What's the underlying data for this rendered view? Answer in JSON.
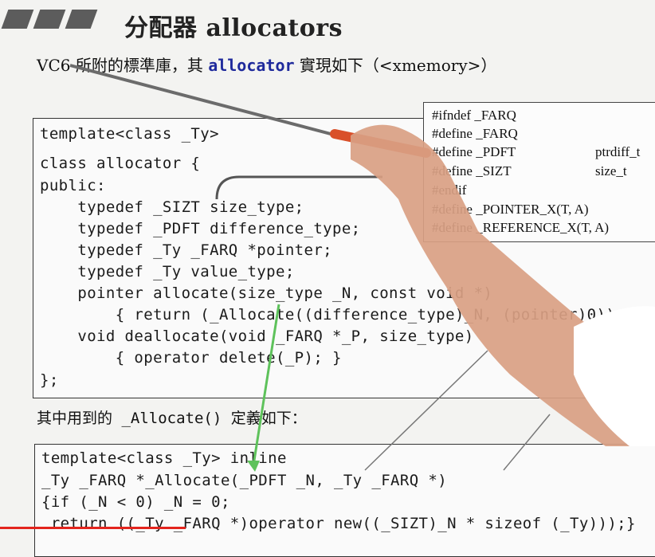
{
  "slide": {
    "title": "分配器 allocators",
    "subtitle_prefix": "VC6 所附的標準庫，其 ",
    "subtitle_kw": "allocator",
    "subtitle_suffix": " 實現如下（<xmemory>）"
  },
  "code_main": {
    "lines": [
      "template<class _Ty>",
      "class allocator {",
      "public:",
      "    typedef _SIZT size_type;",
      "    typedef _PDFT difference_type;",
      "    typedef _Ty _FARQ *pointer;",
      "    typedef _Ty value_type;",
      "    pointer allocate(size_type _N, const void *)",
      "        { return (_Allocate((difference_type)_N, (pointer)0)); }",
      "    void deallocate(void _FARQ *_P, size_type)",
      "        { operator delete(_P); }",
      "};"
    ]
  },
  "defines": {
    "lines": [
      "#ifndef _FARQ",
      "#define _FARQ",
      "#define _PDFT",
      "#define _SIZT",
      "#endif",
      "#define _POINTER_X(T, A)",
      "#define _REFERENCE_X(T, A)"
    ],
    "col2": [
      "ptrdiff_t",
      "size_t"
    ]
  },
  "mid_text": "其中用到的 _Allocate() 定義如下：",
  "code_alloc": {
    "lines": [
      "template<class _Ty> inline",
      "_Ty _FARQ *_Allocate(_PDFT _N, _Ty _FARQ *)",
      "{if (_N < 0) _N = 0;",
      " return ((_Ty _FARQ *)operator new((_SIZT)_N * sizeof (_Ty)));}"
    ]
  }
}
